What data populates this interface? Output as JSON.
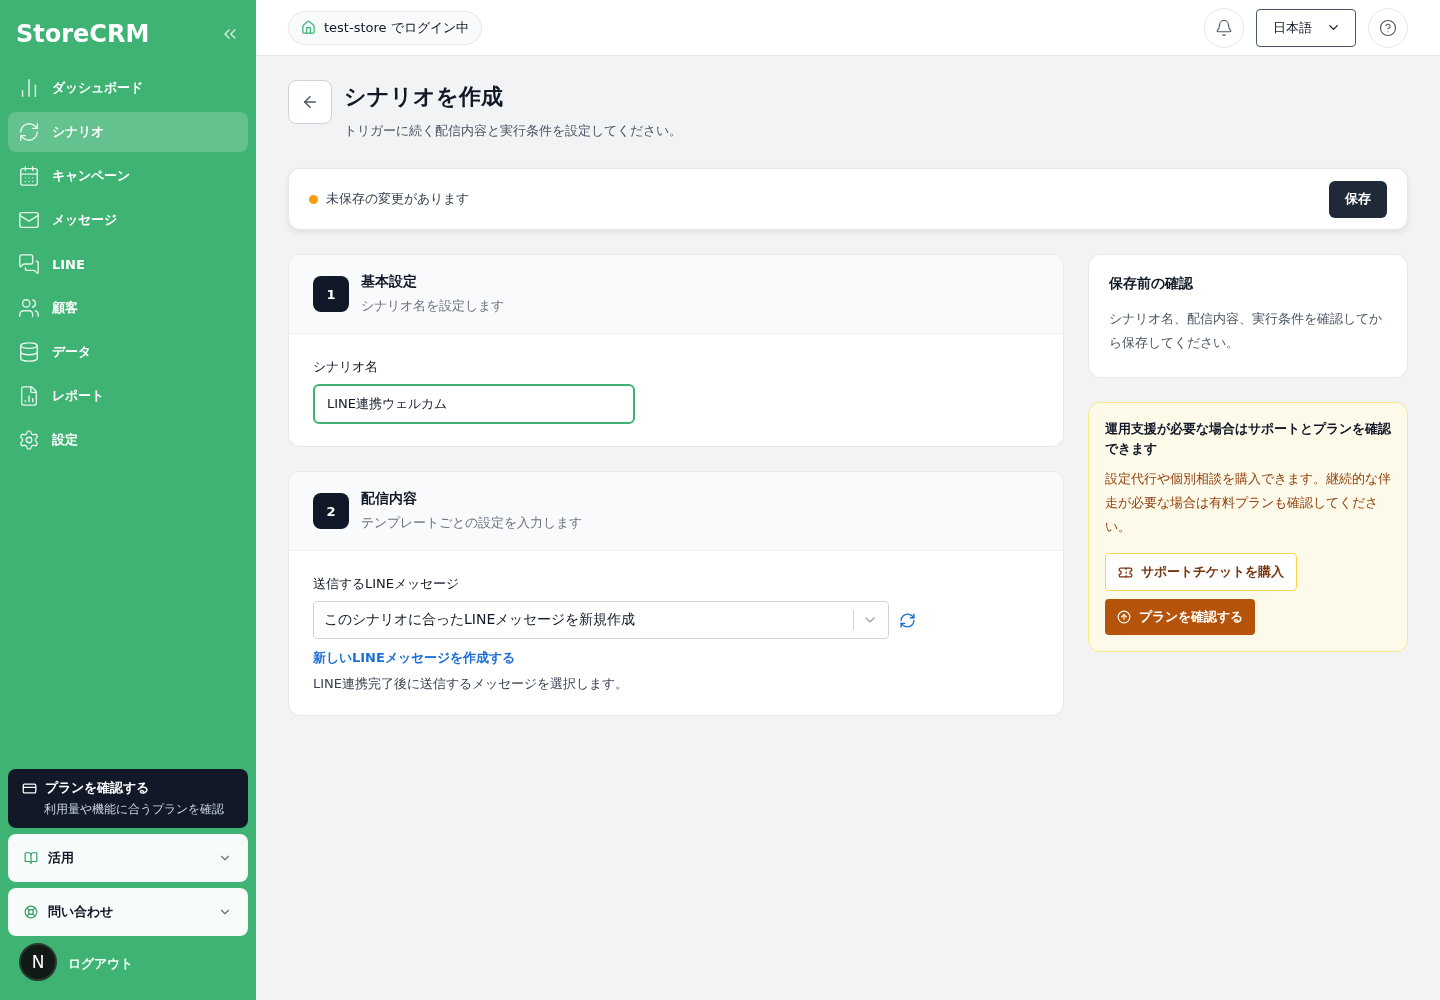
{
  "sidebar": {
    "logo": "StoreCRM",
    "items": [
      {
        "label": "ダッシュボード",
        "selected": false
      },
      {
        "label": "シナリオ",
        "selected": true
      },
      {
        "label": "キャンペーン",
        "selected": false
      },
      {
        "label": "メッセージ",
        "selected": false
      },
      {
        "label": "LINE",
        "selected": false
      },
      {
        "label": "顧客",
        "selected": false
      },
      {
        "label": "データ",
        "selected": false
      },
      {
        "label": "レポート",
        "selected": false
      },
      {
        "label": "設定",
        "selected": false
      }
    ],
    "plan_card": {
      "title": "プランを確認する",
      "subtitle": "利用量や機能に合うプランを確認"
    },
    "sections": [
      {
        "label": "活用",
        "expanded": false
      },
      {
        "label": "問い合わせ",
        "expanded": false
      }
    ],
    "avatar": "N",
    "logout": "ログアウト"
  },
  "header": {
    "store_badge": "test-store でログイン中",
    "language": "日本語"
  },
  "page": {
    "title": "シナリオを作成",
    "subtitle": "トリガーに続く配信内容と実行条件を設定してください。"
  },
  "save_bar": {
    "status": "未保存の変更があります",
    "color": "#f59e0b",
    "button": "保存"
  },
  "steps": [
    {
      "number": "1",
      "title": "基本設定",
      "subtitle": "シナリオ名を設定します",
      "kind": "text",
      "label": "シナリオ名",
      "value": "LINE連携ウェルカム"
    },
    {
      "number": "2",
      "title": "配信内容",
      "subtitle": "テンプレートごとの設定を入力します",
      "kind": "select",
      "label": "送信するLINEメッセージ",
      "value": "このシナリオに合ったLINEメッセージを新規作成",
      "link": "新しいLINEメッセージを作成する",
      "help": "LINE連携完了後に送信するメッセージを選択します。"
    }
  ],
  "confirm_card": {
    "title": "保存前の確認",
    "body": "シナリオ名、配信内容、実行条件を確認してから保存してください。"
  },
  "support_card": {
    "title": "運用支援が必要な場合はサポートとプランを確認できます",
    "body": "設定代行や個別相談を購入できます。継続的な伴走が必要な場合は有料プランも確認してください。",
    "ticket_button": "サポートチケットを購入",
    "plan_button": "プランを確認する"
  }
}
